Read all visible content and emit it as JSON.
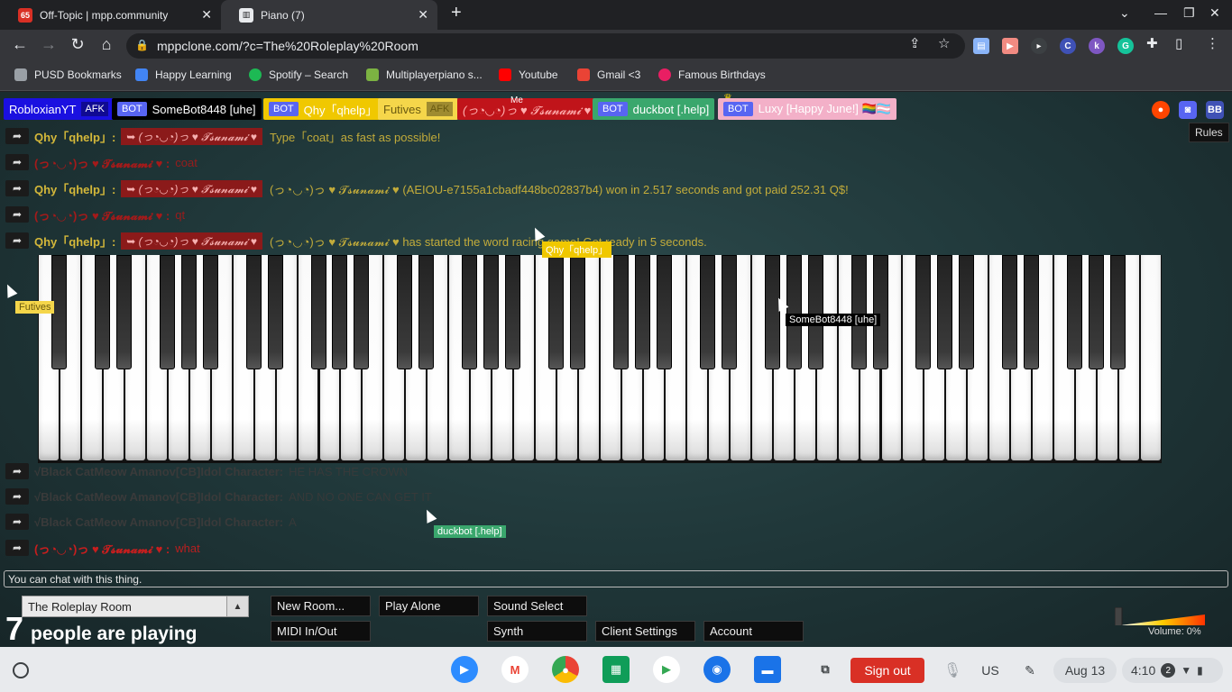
{
  "browser": {
    "tabs": [
      {
        "title": "Off-Topic | mpp.community",
        "badge": "65"
      },
      {
        "title": "Piano (7)"
      }
    ],
    "new_tab": "+",
    "url": "mppclone.com/?c=The%20Roleplay%20Room",
    "bookmarks": [
      "PUSD Bookmarks",
      "Happy Learning",
      "Spotify – Search",
      "Multiplayerpiano s...",
      "Youtube",
      "Gmail <3",
      "Famous Birthdays"
    ]
  },
  "mpp": {
    "users": [
      {
        "name": "RobloxianYT",
        "afk": "AFK",
        "bg": "#1a10e0",
        "fg": "#ffffff"
      },
      {
        "name": "SomeBot8448 [uhe]",
        "bot": "BOT",
        "bg": "#000000",
        "fg": "#ffffff"
      },
      {
        "name": "Qhy「qhelp」",
        "bot": "BOT",
        "bg": "#f0c800",
        "fg": "#ffffff"
      },
      {
        "name": "Futives",
        "afk": "AFK",
        "bg": "#f5d64a",
        "fg": "#6a5a10"
      },
      {
        "name": "(っ◔◡◔)っ ♥ 𝓣𝓼𝓾𝓷𝓪𝓶𝓲 ♥",
        "bg": "#c0141a",
        "fg": "#ffb0b0",
        "me": "Me"
      },
      {
        "name": "duckbot [.help]",
        "bot": "BOT",
        "bg": "#3aa76d",
        "fg": "#ffffff"
      },
      {
        "name": "Luxy [Happy June!] 🏳️‍🌈🏳️‍⚧️",
        "bot": "BOT",
        "bg": "#f3b0c8",
        "fg": "#ffffff"
      }
    ],
    "rules_label": "Rules",
    "chat": [
      {
        "speaker": "Qhy「qhelp」:",
        "tag": "➥ (っ◔◡◔)っ ♥ 𝓣𝓼𝓾𝓷𝓪𝓶𝓲 ♥",
        "text": "Type「coat」as fast as possible!",
        "color": "#d4b83a"
      },
      {
        "speaker": "(っ◔◡◔)っ ♥ 𝓣𝓼𝓾𝓷𝓪𝓶𝓲 ♥ :",
        "text": "coat",
        "color": "#a41a1a"
      },
      {
        "speaker": "Qhy「qhelp」:",
        "tag": "➥ (っ◔◡◔)っ ♥ 𝓣𝓼𝓾𝓷𝓪𝓶𝓲 ♥",
        "text": "(っ◔◡◔)っ ♥ 𝓣𝓼𝓾𝓷𝓪𝓶𝓲 ♥ (AEIOU-e7155a1cbadf448bc02837b4) won in 2.517 seconds and got paid 252.31 Q$!",
        "color": "#d4b83a"
      },
      {
        "speaker": "(っ◔◡◔)っ ♥ 𝓣𝓼𝓾𝓷𝓪𝓶𝓲 ♥ :",
        "text": "qt",
        "color": "#a41a1a"
      },
      {
        "speaker": "Qhy「qhelp」:",
        "tag": "➥ (っ◔◡◔)っ ♥ 𝓣𝓼𝓾𝓷𝓪𝓶𝓲 ♥",
        "text": "(っ◔◡◔)っ ♥ 𝓣𝓼𝓾𝓷𝓪𝓶𝓲 ♥ has started the word racing game! Get ready in 5 seconds.",
        "color": "#d4b83a"
      },
      {
        "speaker": "√Black CatMeow Amanov[CB]Idol Character:",
        "text": "HE HAS THE CROWN",
        "color": "#3a3a3a"
      },
      {
        "speaker": "√Black CatMeow Amanov[CB]Idol Character:",
        "text": "AND NO ONE CAN GET IT",
        "color": "#3a3a3a"
      },
      {
        "speaker": "√Black CatMeow Amanov[CB]Idol Character:",
        "text": "A",
        "color": "#3a3a3a"
      },
      {
        "speaker": "(っ◔◡◔)っ ♥ 𝓣𝓼𝓾𝓷𝓪𝓶𝓲 ♥ :",
        "text": "what",
        "color": "#c81e1e"
      }
    ],
    "reply_glyph": "➦",
    "cursors": [
      {
        "label": "Qhy「qhelp」",
        "bg": "#f0c800",
        "fg": "#ffffff"
      },
      {
        "label": "Futives",
        "bg": "#f5d64a",
        "fg": "#6a5a10"
      },
      {
        "label": "SomeBot8448 [uhe]",
        "bg": "#000000",
        "fg": "#ffffff"
      },
      {
        "label": "duckbot [.help]",
        "bg": "#3aa76d",
        "fg": "#ffffff"
      }
    ],
    "chat_placeholder": "You can chat with this thing.",
    "room_name": "The Roleplay Room",
    "player_count": "7",
    "player_text": "people are playing",
    "buttons": {
      "new_room": "New Room...",
      "play_alone": "Play Alone",
      "sound_select": "Sound Select",
      "midi": "MIDI In/Out",
      "synth": "Synth",
      "client_settings": "Client Settings",
      "account": "Account"
    },
    "volume_label": "Volume: 0%"
  },
  "shelf": {
    "signout": "Sign out",
    "ime": "US",
    "date": "Aug 13",
    "time": "4:10",
    "notif_count": "2"
  }
}
